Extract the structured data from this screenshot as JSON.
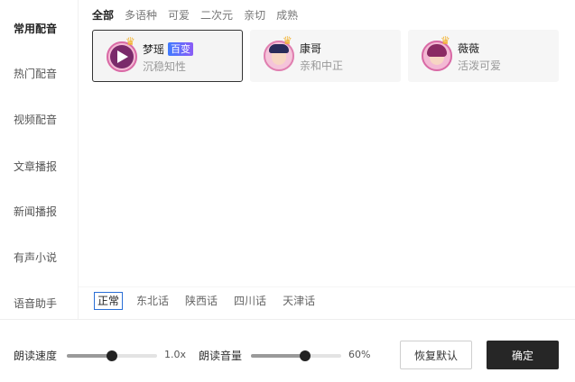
{
  "sidebar": {
    "items": [
      {
        "label": "常用配音",
        "active": true
      },
      {
        "label": "热门配音",
        "active": false
      },
      {
        "label": "视频配音",
        "active": false
      },
      {
        "label": "文章播报",
        "active": false
      },
      {
        "label": "新闻播报",
        "active": false
      },
      {
        "label": "有声小说",
        "active": false
      },
      {
        "label": "语音助手",
        "active": false
      }
    ]
  },
  "style_tabs": [
    {
      "label": "全部",
      "active": true
    },
    {
      "label": "多语种",
      "active": false
    },
    {
      "label": "可爱",
      "active": false
    },
    {
      "label": "二次元",
      "active": false
    },
    {
      "label": "亲切",
      "active": false
    },
    {
      "label": "成熟",
      "active": false
    }
  ],
  "voices": [
    {
      "name": "梦瑶",
      "badge": "百变",
      "desc": "沉稳知性",
      "selected": true,
      "avatar_icon": "female-avatar-playing-icon"
    },
    {
      "name": "康哥",
      "badge": "",
      "desc": "亲和中正",
      "selected": false,
      "avatar_icon": "male-avatar-icon"
    },
    {
      "name": "薇薇",
      "badge": "",
      "desc": "活泼可爱",
      "selected": false,
      "avatar_icon": "female-avatar-icon"
    }
  ],
  "dialects": [
    {
      "label": "正常",
      "active": true
    },
    {
      "label": "东北话",
      "active": false
    },
    {
      "label": "陕西话",
      "active": false
    },
    {
      "label": "四川话",
      "active": false
    },
    {
      "label": "天津话",
      "active": false
    }
  ],
  "controls": {
    "speed_label": "朗读速度",
    "speed_value": "1.0x",
    "speed_fraction": 0.5,
    "volume_label": "朗读音量",
    "volume_value": "60%",
    "volume_fraction": 0.6,
    "reset_label": "恢复默认",
    "ok_label": "确定"
  },
  "colors": {
    "crown": "#f2b230",
    "badge_gradient_start": "#3f7bff",
    "badge_gradient_end": "#8b5cf6",
    "primary_button": "#262626",
    "dialect_selected_border": "#2a6fd6"
  }
}
